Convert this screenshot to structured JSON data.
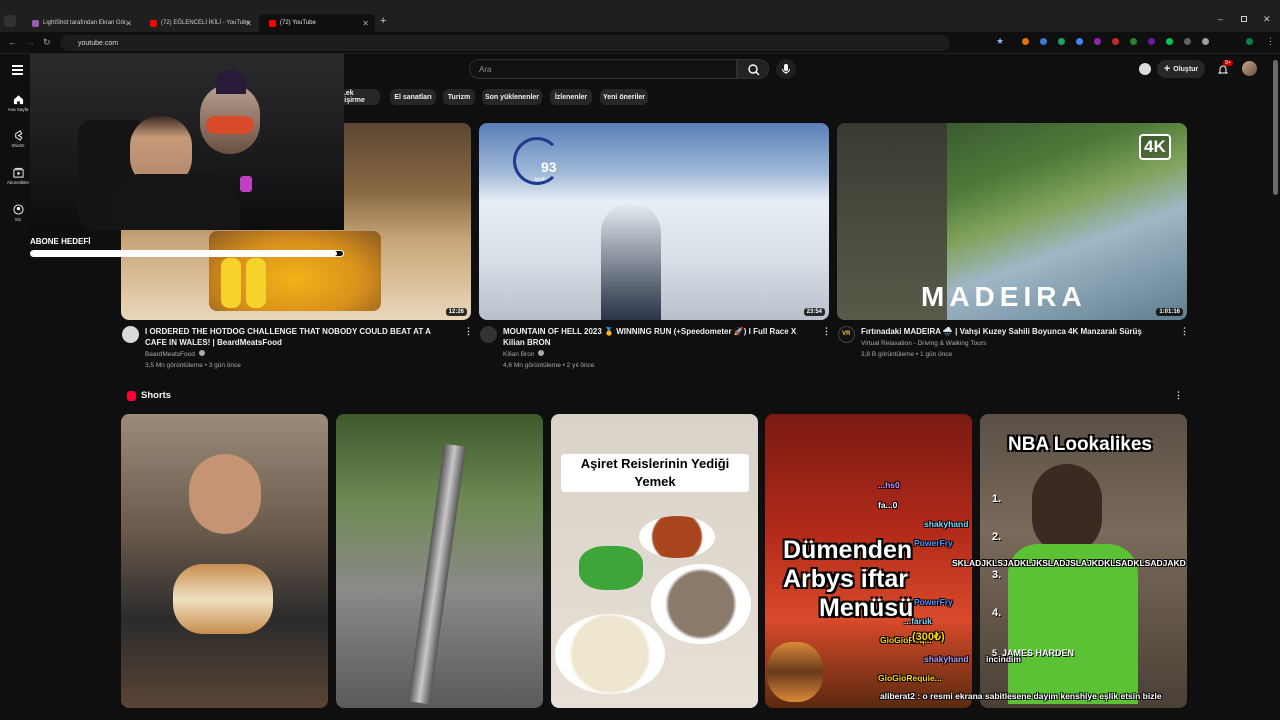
{
  "browser": {
    "tabs": [
      {
        "title": "LightShot tarafından Ekran Gör...",
        "active": false
      },
      {
        "title": "(72) EĞLENCELİ İKİLİ - YouTube",
        "active": false
      },
      {
        "title": "(72) YouTube",
        "active": true
      }
    ],
    "url": "youtube.com"
  },
  "header": {
    "search_placeholder": "Ara",
    "create_label": "Oluştur",
    "notif_badge": "9+"
  },
  "sidebar": {
    "items": [
      {
        "label": "Ana Sayfa",
        "icon": "home-icon"
      },
      {
        "label": "Shorts",
        "icon": "shorts-icon"
      },
      {
        "label": "Abonelikler",
        "icon": "subscriptions-icon"
      },
      {
        "label": "Siz",
        "icon": "you-icon"
      }
    ]
  },
  "chips": [
    "...ek pişirme",
    "El sanatları",
    "Turizm",
    "Son yüklenenler",
    "İzlenenler",
    "Yeni öneriler"
  ],
  "videos": [
    {
      "title": "I ORDERED THE HOTDOG CHALLENGE THAT NOBODY COULD BEAT AT A CAFE IN WALES! | BeardMeatsFood",
      "channel": "BeardMeatsFood",
      "stats": "3,5 Mn görüntüleme • 3 gün önce",
      "duration": "12:26"
    },
    {
      "title": "MOUNTAIN OF HELL 2023 🥇 WINNING RUN (+Speedometer 🚀) I Full Race X Kilian BRON",
      "channel": "Kilian Bron",
      "stats": "4,6 Mn görüntüleme • 2 yıl önce",
      "duration": "23:54",
      "speed": "93",
      "speed_unit": "km/h"
    },
    {
      "title": "Fırtınadaki MADEIRA 🌧️ | Vahşi Kuzey Sahili Boyunca 4K Manzaralı Sürüş",
      "channel": "Virtual Relaxation - Driving & Walking Tours",
      "stats": "3,8 B görüntüleme • 1 gün önce",
      "duration": "1:01:16",
      "badge": "4K",
      "overlay": "MADEIRA"
    }
  ],
  "shorts": {
    "heading": "Shorts",
    "items": [
      {
        "caption": ""
      },
      {
        "caption": ""
      },
      {
        "caption_line1": "Aşiret Reislerinin Yediği",
        "caption_line2": "Yemek"
      },
      {
        "caption_line1": "Dümenden",
        "caption_line2": "Arbys iftar",
        "caption_line3": "Menüsü"
      },
      {
        "caption": "NBA Lookalikes",
        "list": [
          "1.",
          "2.",
          "3.",
          "4.",
          "5. JAMES HARDEN"
        ]
      }
    ]
  },
  "stream": {
    "goal_label": "ABONE HEDEFİ",
    "goal_progress": 0.98,
    "chat": [
      {
        "user": "...hs0",
        "msg": ""
      },
      {
        "user": "fa...0",
        "msg": ""
      },
      {
        "user": "shakyhand",
        "msg": ""
      },
      {
        "user": "PowerFry",
        "msg": ""
      },
      {
        "user": "",
        "msg": "SKLADJKLSJADKLJKSLADJSLAJKDKLSADKLSADJAKD"
      },
      {
        "user": "PowerFry",
        "msg": ""
      },
      {
        "user": "...faruk",
        "msg": ""
      },
      {
        "user": "GioGioReq...",
        "msg": "(300₺)"
      },
      {
        "user": "shakyhand",
        "msg": "incindim"
      },
      {
        "user": "GioGioRequie...",
        "msg": ""
      }
    ],
    "pinned": "aliberat2 : o resmi ekrana sabitlesene dayım kenshiye eşlik etsin bizle"
  }
}
